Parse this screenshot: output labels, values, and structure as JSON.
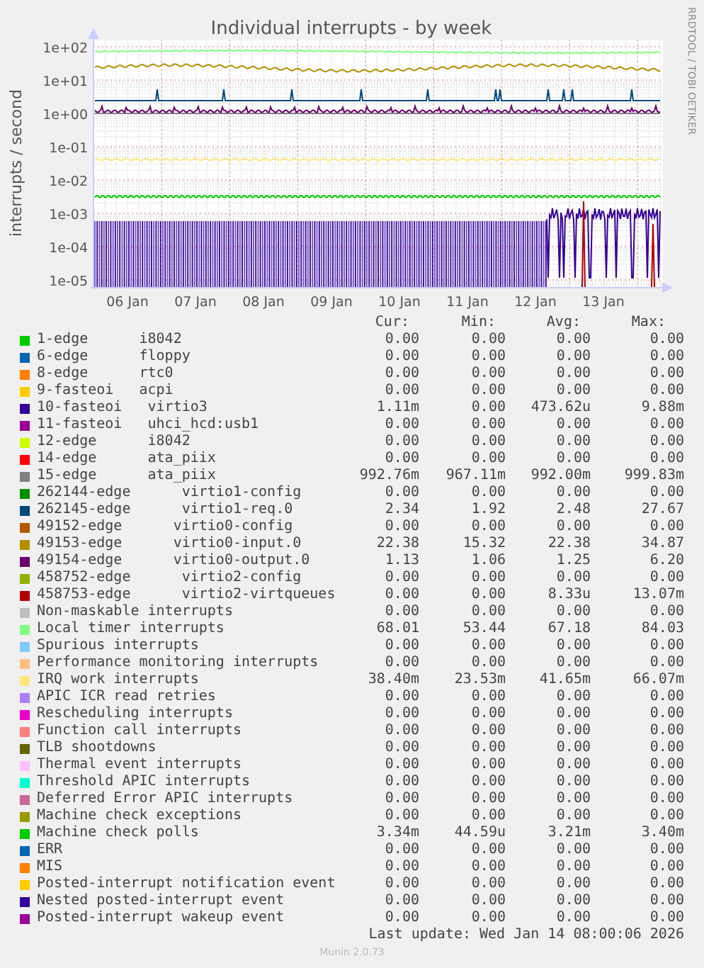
{
  "graph": {
    "title": "Individual interrupts - by week",
    "ylabel": "interrupts / second",
    "side_text": "RRDTOOL / TOBI OETIKER",
    "y_ticks": [
      "1e+02",
      "1e+01",
      "1e+00",
      "1e-01",
      "1e-02",
      "1e-03",
      "1e-04",
      "1e-05"
    ],
    "x_ticks": [
      "06 Jan",
      "07 Jan",
      "08 Jan",
      "09 Jan",
      "10 Jan",
      "11 Jan",
      "12 Jan",
      "13 Jan"
    ]
  },
  "legend": {
    "columns": [
      "Cur:",
      "Min:",
      "Avg:",
      "Max:"
    ],
    "rows": [
      {
        "label": "1-edge      i8042",
        "color": "#00cc00",
        "cur": "0.00",
        "min": "0.00",
        "avg": "0.00",
        "max": "0.00"
      },
      {
        "label": "6-edge      floppy",
        "color": "#0066b3",
        "cur": "0.00",
        "min": "0.00",
        "avg": "0.00",
        "max": "0.00"
      },
      {
        "label": "8-edge      rtc0",
        "color": "#ff8000",
        "cur": "0.00",
        "min": "0.00",
        "avg": "0.00",
        "max": "0.00"
      },
      {
        "label": "9-fasteoi   acpi",
        "color": "#ffcc00",
        "cur": "0.00",
        "min": "0.00",
        "avg": "0.00",
        "max": "0.00"
      },
      {
        "label": "10-fasteoi   virtio3",
        "color": "#330099",
        "cur": "1.11m",
        "min": "0.00",
        "avg": "473.62u",
        "max": "9.88m"
      },
      {
        "label": "11-fasteoi   uhci_hcd:usb1",
        "color": "#990099",
        "cur": "0.00",
        "min": "0.00",
        "avg": "0.00",
        "max": "0.00"
      },
      {
        "label": "12-edge      i8042",
        "color": "#ccff00",
        "cur": "0.00",
        "min": "0.00",
        "avg": "0.00",
        "max": "0.00"
      },
      {
        "label": "14-edge      ata_piix",
        "color": "#ff0000",
        "cur": "0.00",
        "min": "0.00",
        "avg": "0.00",
        "max": "0.00"
      },
      {
        "label": "15-edge      ata_piix",
        "color": "#808080",
        "cur": "992.76m",
        "min": "967.11m",
        "avg": "992.00m",
        "max": "999.83m"
      },
      {
        "label": "262144-edge      virtio1-config",
        "color": "#008f00",
        "cur": "0.00",
        "min": "0.00",
        "avg": "0.00",
        "max": "0.00"
      },
      {
        "label": "262145-edge      virtio1-req.0",
        "color": "#00487d",
        "cur": "2.34",
        "min": "1.92",
        "avg": "2.48",
        "max": "27.67"
      },
      {
        "label": "49152-edge      virtio0-config",
        "color": "#b35a00",
        "cur": "0.00",
        "min": "0.00",
        "avg": "0.00",
        "max": "0.00"
      },
      {
        "label": "49153-edge      virtio0-input.0",
        "color": "#b38f00",
        "cur": "22.38",
        "min": "15.32",
        "avg": "22.38",
        "max": "34.87"
      },
      {
        "label": "49154-edge      virtio0-output.0",
        "color": "#6b006b",
        "cur": "1.13",
        "min": "1.06",
        "avg": "1.25",
        "max": "6.20"
      },
      {
        "label": "458752-edge      virtio2-config",
        "color": "#8fb300",
        "cur": "0.00",
        "min": "0.00",
        "avg": "0.00",
        "max": "0.00"
      },
      {
        "label": "458753-edge      virtio2-virtqueues",
        "color": "#b30000",
        "cur": "0.00",
        "min": "0.00",
        "avg": "8.33u",
        "max": "13.07m"
      },
      {
        "label": "Non-maskable interrupts",
        "color": "#bebebe",
        "cur": "0.00",
        "min": "0.00",
        "avg": "0.00",
        "max": "0.00"
      },
      {
        "label": "Local timer interrupts",
        "color": "#80ff80",
        "cur": "68.01",
        "min": "53.44",
        "avg": "67.18",
        "max": "84.03"
      },
      {
        "label": "Spurious interrupts",
        "color": "#80c9ff",
        "cur": "0.00",
        "min": "0.00",
        "avg": "0.00",
        "max": "0.00"
      },
      {
        "label": "Performance monitoring interrupts",
        "color": "#ffc080",
        "cur": "0.00",
        "min": "0.00",
        "avg": "0.00",
        "max": "0.00"
      },
      {
        "label": "IRQ work interrupts",
        "color": "#ffe680",
        "cur": "38.40m",
        "min": "23.53m",
        "avg": "41.65m",
        "max": "66.07m"
      },
      {
        "label": "APIC ICR read retries",
        "color": "#aa80ff",
        "cur": "0.00",
        "min": "0.00",
        "avg": "0.00",
        "max": "0.00"
      },
      {
        "label": "Rescheduling interrupts",
        "color": "#ee00cc",
        "cur": "0.00",
        "min": "0.00",
        "avg": "0.00",
        "max": "0.00"
      },
      {
        "label": "Function call interrupts",
        "color": "#ff8080",
        "cur": "0.00",
        "min": "0.00",
        "avg": "0.00",
        "max": "0.00"
      },
      {
        "label": "TLB shootdowns",
        "color": "#666600",
        "cur": "0.00",
        "min": "0.00",
        "avg": "0.00",
        "max": "0.00"
      },
      {
        "label": "Thermal event interrupts",
        "color": "#ffbfff",
        "cur": "0.00",
        "min": "0.00",
        "avg": "0.00",
        "max": "0.00"
      },
      {
        "label": "Threshold APIC interrupts",
        "color": "#00ffcc",
        "cur": "0.00",
        "min": "0.00",
        "avg": "0.00",
        "max": "0.00"
      },
      {
        "label": "Deferred Error APIC interrupts",
        "color": "#cc6699",
        "cur": "0.00",
        "min": "0.00",
        "avg": "0.00",
        "max": "0.00"
      },
      {
        "label": "Machine check exceptions",
        "color": "#999900",
        "cur": "0.00",
        "min": "0.00",
        "avg": "0.00",
        "max": "0.00"
      },
      {
        "label": "Machine check polls",
        "color": "#00cc00",
        "cur": "3.34m",
        "min": "44.59u",
        "avg": "3.21m",
        "max": "3.40m"
      },
      {
        "label": "ERR",
        "color": "#0066b3",
        "cur": "0.00",
        "min": "0.00",
        "avg": "0.00",
        "max": "0.00"
      },
      {
        "label": "MIS",
        "color": "#ff8000",
        "cur": "0.00",
        "min": "0.00",
        "avg": "0.00",
        "max": "0.00"
      },
      {
        "label": "Posted-interrupt notification event",
        "color": "#ffcc00",
        "cur": "0.00",
        "min": "0.00",
        "avg": "0.00",
        "max": "0.00"
      },
      {
        "label": "Nested posted-interrupt event",
        "color": "#330099",
        "cur": "0.00",
        "min": "0.00",
        "avg": "0.00",
        "max": "0.00"
      },
      {
        "label": "Posted-interrupt wakeup event",
        "color": "#990099",
        "cur": "0.00",
        "min": "0.00",
        "avg": "0.00",
        "max": "0.00"
      }
    ]
  },
  "last_update": "Last update: Wed Jan 14 08:00:06 2026",
  "footer": "Munin 2.0.73"
}
